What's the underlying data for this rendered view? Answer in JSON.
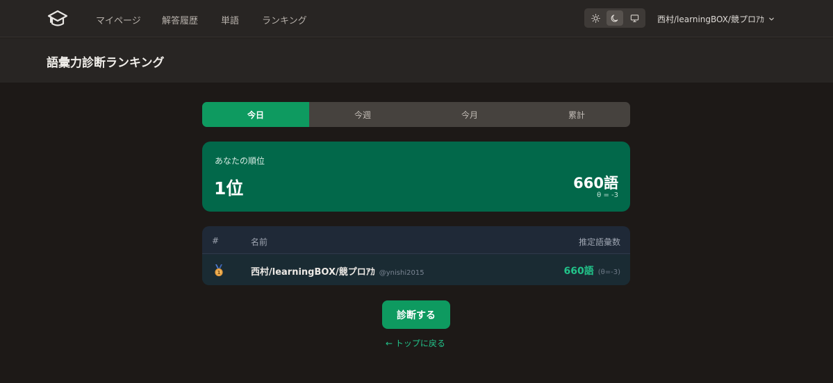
{
  "colors": {
    "accent": "#0e9a60",
    "accent_text": "#22c38a",
    "card_bg": "#02684a",
    "page_bg": "#1d1917",
    "header_bg": "#282523",
    "table_bg": "#1f2937"
  },
  "nav": {
    "logo_icon": "graduation-cap-icon",
    "links": [
      "マイページ",
      "解答履歴",
      "単語",
      "ランキング"
    ],
    "theme_options": [
      {
        "icon": "sun-icon",
        "active": false
      },
      {
        "icon": "moon-icon",
        "active": true
      },
      {
        "icon": "monitor-icon",
        "active": false
      }
    ],
    "user_name": "西村/learningBOX/競プロｱｶ"
  },
  "page": {
    "title": "語彙力診断ランキング"
  },
  "tabs": [
    {
      "label": "今日",
      "active": true
    },
    {
      "label": "今週",
      "active": false
    },
    {
      "label": "今月",
      "active": false
    },
    {
      "label": "累計",
      "active": false
    }
  ],
  "my_rank": {
    "label": "あなたの順位",
    "rank": "1位",
    "vocab": "660語",
    "theta": "θ = -3"
  },
  "table": {
    "headers": {
      "rank": "#",
      "name": "名前",
      "vocab": "推定語彙数"
    },
    "rows": [
      {
        "rank_icon": "medal-icon",
        "name": "西村/learningBOX/競プロｱｶ",
        "handle": "@ynishi2015",
        "vocab": "660語",
        "theta": "(θ=-3)"
      }
    ]
  },
  "actions": {
    "diagnose_label": "診断する",
    "back_label": "← トップに戻る"
  }
}
